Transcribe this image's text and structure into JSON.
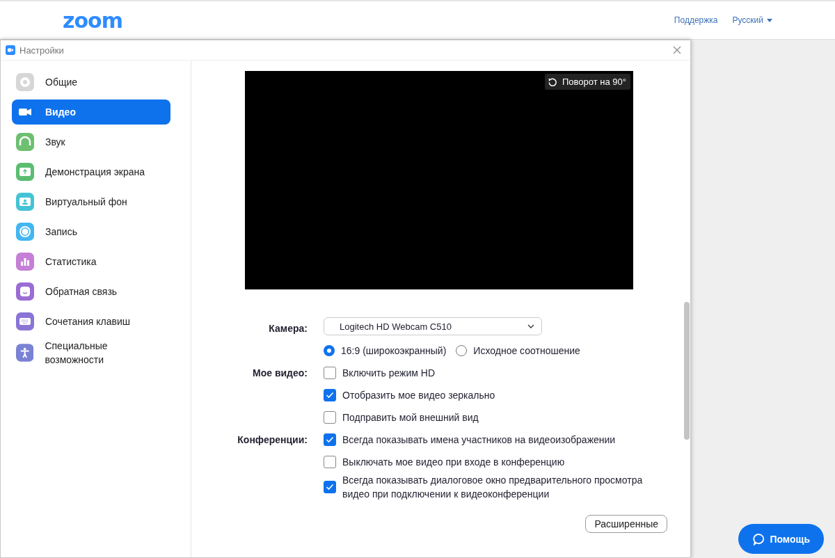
{
  "header": {
    "logo": "zoom",
    "links": [
      {
        "label": "Поддержка",
        "kind": "link"
      },
      {
        "label": "Русский",
        "kind": "dropdown"
      }
    ]
  },
  "window": {
    "title": "Настройки"
  },
  "sidebar": {
    "items": [
      {
        "label": "Общие",
        "color": "#d6d6d6",
        "selected": false
      },
      {
        "label": "Видео",
        "selected": true
      },
      {
        "label": "Звук",
        "color": "#6cc070",
        "selected": false
      },
      {
        "label": "Демонстрация экрана",
        "color": "#5bbd72",
        "selected": false
      },
      {
        "label": "Виртуальный фон",
        "color": "#45c3d6",
        "selected": false
      },
      {
        "label": "Запись",
        "color": "#43b6f0",
        "selected": false
      },
      {
        "label": "Статистика",
        "color": "#c57fd6",
        "selected": false
      },
      {
        "label": "Обратная связь",
        "color": "#9a6cd4",
        "selected": false
      },
      {
        "label": "Сочетания клавиш",
        "color": "#8a74d6",
        "selected": false
      },
      {
        "label": "Специальные возможности",
        "color": "#7a82d4",
        "selected": false
      }
    ]
  },
  "preview": {
    "rotate_button": "Поворот на 90°"
  },
  "settings": [
    {
      "label": "Камера:",
      "kind": "select",
      "value": "Logitech HD Webcam C510"
    },
    {
      "kind": "radios",
      "options": [
        {
          "label": "16:9 (широкоэкранный)",
          "selected": true
        },
        {
          "label": "Исходное соотношение",
          "selected": false
        }
      ]
    },
    {
      "label": "Мое видео:",
      "kind": "checkbox",
      "text": "Включить режим HD",
      "checked": false
    },
    {
      "kind": "checkbox",
      "text": "Отобразить мое видео зеркально",
      "checked": true
    },
    {
      "kind": "checkbox",
      "text": "Подправить мой внешний вид",
      "checked": false
    },
    {
      "label": "Конференции:",
      "kind": "checkbox",
      "text": "Всегда показывать имена участников на видеоизображении",
      "checked": true
    },
    {
      "kind": "checkbox",
      "text": "Выключать мое видео при входе в конференцию",
      "checked": false
    },
    {
      "kind": "checkbox",
      "text": "Всегда показывать диалоговое окно предварительного просмотра видео при подключении к видеоконференции",
      "checked": true
    }
  ],
  "advanced_button": "Расширенные",
  "help_button": "Помощь"
}
